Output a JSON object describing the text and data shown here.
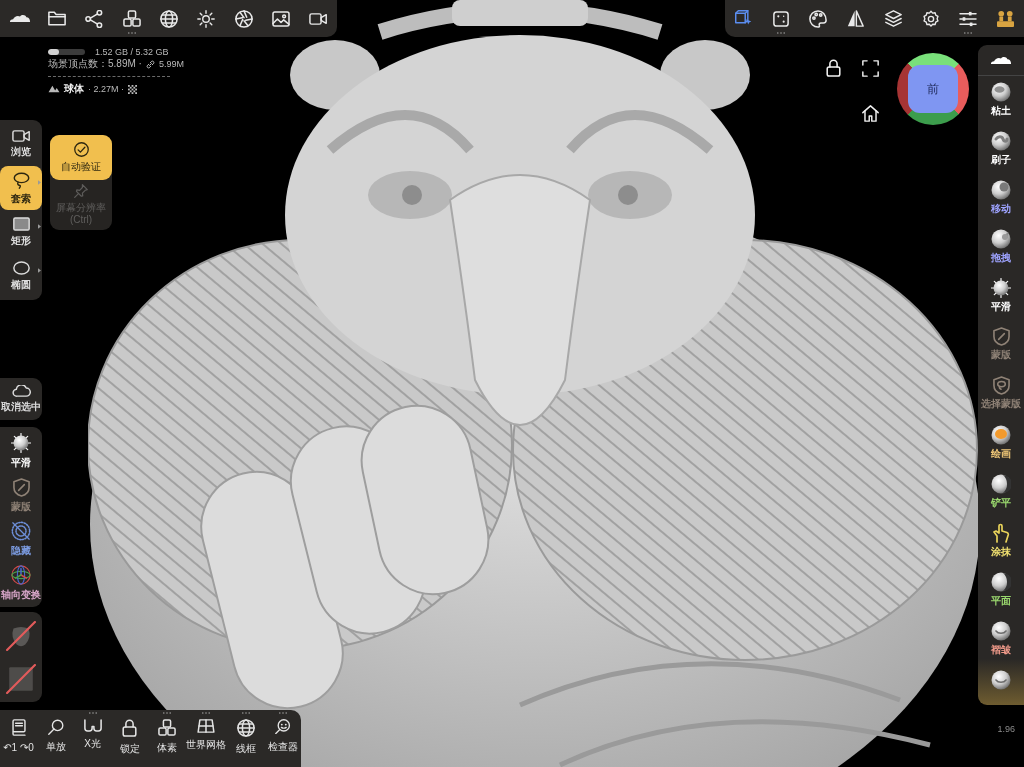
{
  "top_left_toolbar": [
    {
      "has_options": false
    },
    {
      "has_options": false
    },
    {
      "has_options": false
    },
    {
      "has_options": true
    },
    {
      "has_options": false
    },
    {
      "has_options": false
    },
    {
      "has_options": false
    },
    {
      "has_options": false
    },
    {
      "has_options": false
    }
  ],
  "top_right_toolbar": [
    {
      "selected": true,
      "has_options": false
    },
    {
      "selected": false,
      "has_options": true
    },
    {
      "selected": false,
      "has_options": false
    },
    {
      "selected": false,
      "has_options": false
    },
    {
      "selected": false,
      "has_options": false
    },
    {
      "selected": false,
      "has_options": false
    },
    {
      "selected": false,
      "has_options": true
    },
    {
      "selected": false,
      "has_options": false
    }
  ],
  "scene_stats": {
    "memory": {
      "level": 0.29,
      "reading": "1.52 GB / 5.32 GB"
    },
    "vertices": {
      "label": "场景顶点数：5.89M ·",
      "linked": "5.99M"
    },
    "active_object": {
      "name": "球体",
      "count": "· 2.27M ·"
    }
  },
  "view_cube": {
    "face": "前"
  },
  "select_tools": [
    {
      "label": "浏览",
      "selected": false,
      "has_options": false
    },
    {
      "label": "套索",
      "selected": true,
      "has_options": true
    },
    {
      "label": "矩形",
      "selected": false,
      "has_options": true
    },
    {
      "label": "椭圆",
      "selected": false,
      "has_options": true
    }
  ],
  "select_options": [
    {
      "label": "自动验证",
      "on": true,
      "disabled": false
    },
    {
      "label": "屏幕分辨率 (Ctrl)",
      "on": false,
      "disabled": true
    }
  ],
  "deselect": {
    "label": "取消选中"
  },
  "selection_actions": [
    {
      "label": "平滑",
      "color": "#ffffff"
    },
    {
      "label": "蒙版",
      "color": "#8f8276"
    },
    {
      "label": "隐藏",
      "color": "#7b9be0"
    },
    {
      "label": "轴向变换",
      "color": "#dba8cc"
    }
  ],
  "stroke_swatches": [
    {
      "disabled": true
    },
    {
      "disabled": true
    }
  ],
  "brushes": [
    {
      "label": "粘土",
      "color": "#ffffff"
    },
    {
      "label": "刷子",
      "color": "#ffffff"
    },
    {
      "label": "移动",
      "color": "#9ea3ff"
    },
    {
      "label": "拖拽",
      "color": "#9ea3ff"
    },
    {
      "label": "平滑",
      "color": "#ffffff"
    },
    {
      "label": "蒙版",
      "color": "#8f8276"
    },
    {
      "label": "选择蒙版",
      "color": "#8f8276"
    },
    {
      "label": "绘画",
      "color": "#f0c878"
    },
    {
      "label": "铲平",
      "color": "#9ad86e"
    },
    {
      "label": "涂抹",
      "color": "#f0e070"
    },
    {
      "label": "平面",
      "color": "#9ad86e"
    },
    {
      "label": "褶皱",
      "color": "#f09a8a"
    }
  ],
  "bottom_toolbar": [
    {
      "label": "↶1 ↷0",
      "has_options": false
    },
    {
      "label": "单放",
      "has_options": false
    },
    {
      "label": "X光",
      "has_options": true
    },
    {
      "label": "锁定",
      "has_options": false
    },
    {
      "label": "体素",
      "has_options": true
    },
    {
      "label": "世界网格",
      "has_options": true
    },
    {
      "label": "线框",
      "has_options": true
    },
    {
      "label": "检查器",
      "has_options": true
    }
  ],
  "zoom_reading": "1.96"
}
